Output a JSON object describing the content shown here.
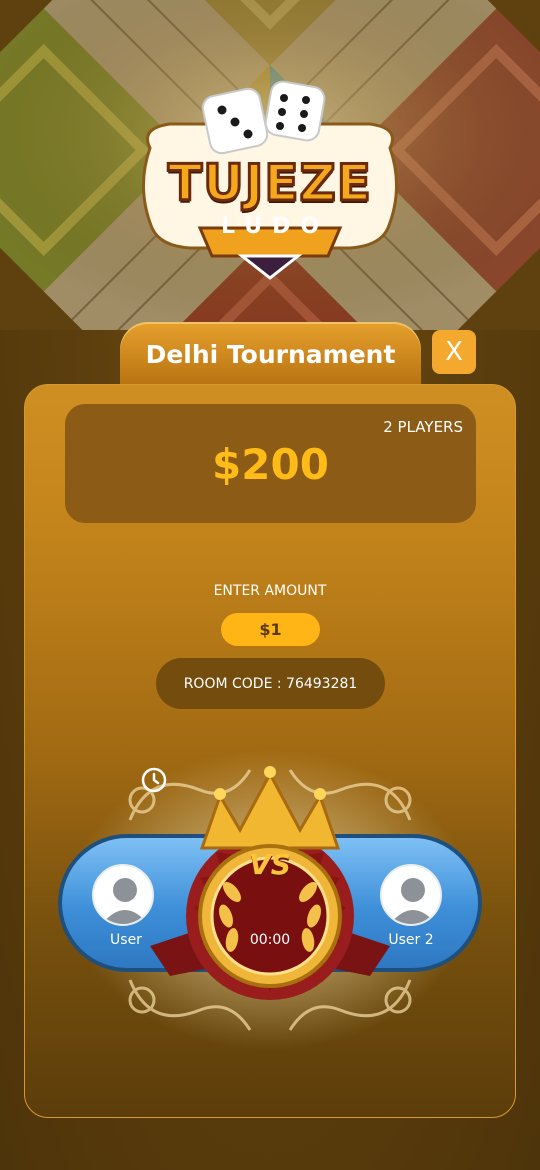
{
  "logo": {
    "title": "TUJEZE",
    "subtitle": "LUDO"
  },
  "tournament": {
    "title": "Delhi Tournament",
    "close_label": "X"
  },
  "prize": {
    "players": "2 PLAYERS",
    "amount": "$200"
  },
  "entry": {
    "label": "ENTER AMOUNT",
    "amount": "$1"
  },
  "room": {
    "code_text": "ROOM CODE : 76493281"
  },
  "match": {
    "vs_label": "VS",
    "player1": "User",
    "player2": "User 2",
    "timer": "00:00"
  },
  "colors": {
    "accent": "#ffb515",
    "panel": "#c3841b",
    "prize_text": "#ffbb16",
    "user_bar": "#3d8fd8",
    "badge_red": "#8a1c1c"
  },
  "icons": [
    "dice-icon",
    "close-icon",
    "avatar-icon",
    "crown-icon",
    "clock-icon"
  ]
}
